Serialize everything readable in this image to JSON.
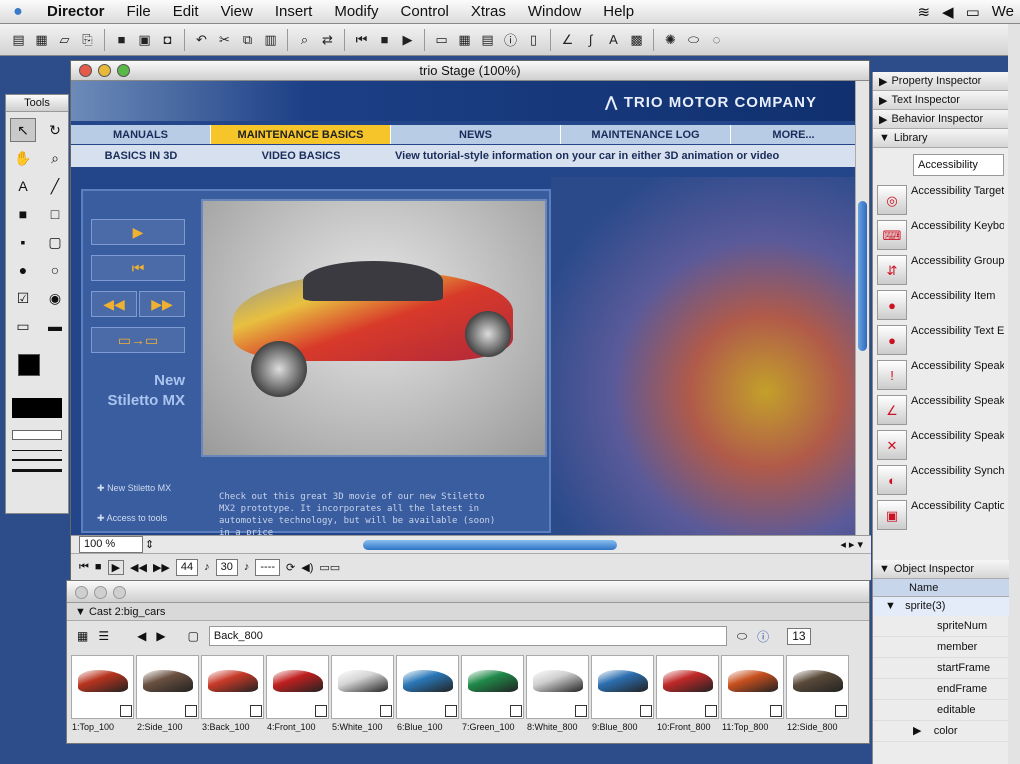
{
  "menubar": {
    "app": "Director",
    "items": [
      "File",
      "Edit",
      "View",
      "Insert",
      "Modify",
      "Control",
      "Xtras",
      "Window",
      "Help"
    ],
    "right_text": "We"
  },
  "tools_panel": {
    "title": "Tools"
  },
  "stage": {
    "title": "trio Stage (100%)",
    "zoom": "100 %",
    "frame": "44",
    "tempo": "30",
    "fps_actual": "----"
  },
  "site": {
    "brand": "TRIO MOTOR COMPANY",
    "nav": [
      "MANUALS",
      "MAINTENANCE BASICS",
      "NEWS",
      "MAINTENANCE LOG",
      "MORE..."
    ],
    "subnav": [
      "BASICS IN 3D",
      "VIDEO BASICS"
    ],
    "subnav_desc": "View tutorial-style information on your car in either 3D animation or video",
    "feature_label": "New Stiletto MX",
    "description": "Check out this great 3D movie of our new Stiletto MX2 prototype. It incorporates all the latest in automotive technology, but will be available (soon) in a price",
    "side_links": [
      "New Stiletto MX",
      "Access to tools"
    ]
  },
  "right_panel": {
    "tabs": [
      "Property Inspector",
      "Text Inspector",
      "Behavior Inspector",
      "Library"
    ],
    "library_category": "Accessibility",
    "library_items": [
      "Accessibility Target",
      "Accessibility Keyboard Controller",
      "Accessibility Group Order",
      "Accessibility Item",
      "Accessibility Text Edit Item",
      "Accessibility Speak",
      "Accessibility Speak Member Text",
      "Accessibility Speak Enable Disable",
      "Accessibility Synch Caption",
      "Accessibility Captioning"
    ],
    "object_inspector": {
      "title": "Object Inspector",
      "column": "Name",
      "selected": "sprite(3)",
      "props": [
        "spriteNum",
        "member",
        "startFrame",
        "endFrame",
        "editable",
        "color"
      ]
    }
  },
  "cast": {
    "title": "Cast 2:big_cars",
    "field_value": "Back_800",
    "count": "13",
    "members": [
      {
        "label": "1:Top_100",
        "color": "#b8341e"
      },
      {
        "label": "2:Side_100",
        "color": "#6a5040"
      },
      {
        "label": "3:Back_100",
        "color": "#c83a28"
      },
      {
        "label": "4:Front_100",
        "color": "#c02020"
      },
      {
        "label": "5:White_100",
        "color": "#d6d6d6"
      },
      {
        "label": "6:Blue_100",
        "color": "#2a78b8"
      },
      {
        "label": "7:Green_100",
        "color": "#1f8a4a"
      },
      {
        "label": "8:White_800",
        "color": "#cfcfcf"
      },
      {
        "label": "9:Blue_800",
        "color": "#2c6fb0"
      },
      {
        "label": "10:Front_800",
        "color": "#c02828"
      },
      {
        "label": "11:Top_800",
        "color": "#c8501e"
      },
      {
        "label": "12:Side_800",
        "color": "#5a4a3a"
      }
    ]
  }
}
